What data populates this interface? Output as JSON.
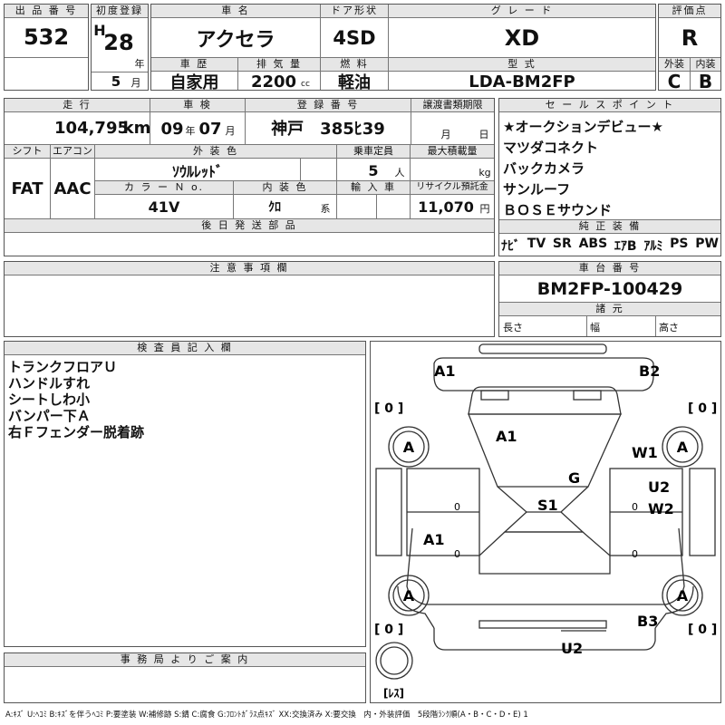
{
  "header": {
    "lot_label": "出 品 番 号",
    "lot_value": "532",
    "first_reg_label": "初度登録",
    "era": "H",
    "year": "28",
    "year_unit": "年",
    "month": "5",
    "month_unit": "月",
    "name_label": "車 名",
    "name_value": "アクセラ",
    "door_label": "ドア形状",
    "door_value": "4SD",
    "grade_label": "グ レ ー ド",
    "grade_value": "XD",
    "score_label": "評価点",
    "score_value": "R",
    "history_label": "車 歴",
    "history_value": "自家用",
    "disp_label": "排 気 量",
    "disp_value": "2200",
    "disp_unit": "cc",
    "fuel_label": "燃 料",
    "fuel_value": "軽油",
    "model_label": "型 式",
    "model_value": "LDA-BM2FP",
    "ext_label": "外装",
    "ext_value": "C",
    "int_label": "内装",
    "int_value": "B"
  },
  "row2": {
    "mileage_label": "走 行",
    "mileage_value": "104,795",
    "mileage_unit": "km",
    "inspection_label": "車 検",
    "insp_year": "09",
    "insp_year_unit": "年",
    "insp_month": "07",
    "insp_month_unit": "月",
    "plate_label": "登 録 番 号",
    "plate_value": "神戸　385ﾋ39",
    "transfer_label": "譲渡書類期限",
    "transfer_month": "月",
    "transfer_day": "日",
    "shift_label": "シフト",
    "shift_value": "FAT",
    "ac_label": "エアコン",
    "ac_value": "AAC",
    "color_label": "外 装 色",
    "color_value": "ｿｳﾙﾚｯﾄﾞ",
    "capacity_label": "乗車定員",
    "capacity_value": "5",
    "capacity_unit": "人",
    "load_label": "最大積載量",
    "load_unit": "kg",
    "colorno_label": "カ ラ ー Ｎ o.",
    "colorno_value": "41V",
    "interior_label": "内 装 色",
    "interior_value": "ｸﾛ",
    "interior_unit": "系",
    "import_label": "輸 入 車",
    "recycle_label": "リサイクル預託金",
    "recycle_value": "11,070",
    "recycle_unit": "円",
    "later_label": "後 日 発 送 部 品"
  },
  "sales_points": {
    "label": "セ ー ル ス ポ イ ン ト",
    "items": [
      "★オークションデビュー★",
      "マツダコネクト",
      "バックカメラ",
      "サンルーフ",
      "ＢＯＳＥサウンド"
    ]
  },
  "equipment": {
    "label": "純 正 装 備",
    "items": [
      "ﾅﾋﾞ",
      "TV",
      "SR",
      "ABS",
      "ｴｱB",
      "ｱﾙﾐ",
      "PS",
      "PW"
    ]
  },
  "caution": {
    "label": "注 意 事 項 欄"
  },
  "chassis": {
    "label": "車 台 番 号",
    "value": "BM2FP-100429",
    "spec_label": "諸 元",
    "length_label": "長さ",
    "width_label": "幅",
    "height_label": "高さ"
  },
  "inspector": {
    "label": "検 査 員 記 入 欄",
    "notes": [
      "トランクフロアＵ",
      "ハンドルすれ",
      "シートしわ小",
      "バンパー下Ａ",
      "右Ｆフェンダー脱着跡"
    ]
  },
  "office": {
    "label": "事 務 局 よ り ご 案 内"
  },
  "diagram": {
    "marks": {
      "a1_trunk": "A1",
      "b2_rear": "B2",
      "a1_rear_glass": "A1",
      "w1": "W1",
      "g": "G",
      "u2_door": "U2",
      "w2": "W2",
      "s1": "S1",
      "a1_hood": "A1",
      "b3": "B3",
      "u2_front": "U2"
    },
    "tires": [
      "A",
      "A",
      "A",
      "A"
    ],
    "tire_depth": [
      "[ 0 ]",
      "[ 0 ]",
      "[ 0 ]",
      "[ 0 ]"
    ],
    "tread_marks": [
      "0",
      "0",
      "0",
      "0"
    ],
    "spare_label": "[ﾚｽ]"
  },
  "legend": "A:ｷｽﾞ U:ﾍｺﾐ B:ｷｽﾞを伴うﾍｺﾐ P:要塗装 W:補修跡 S:錆 C:腐食 G:ﾌﾛﾝﾄｶﾞﾗｽ点ｷｽﾞ XX:交換済み X:要交換　内・外装評価　5段階ﾗﾝｸ順(A・B・C・D・E) 1"
}
